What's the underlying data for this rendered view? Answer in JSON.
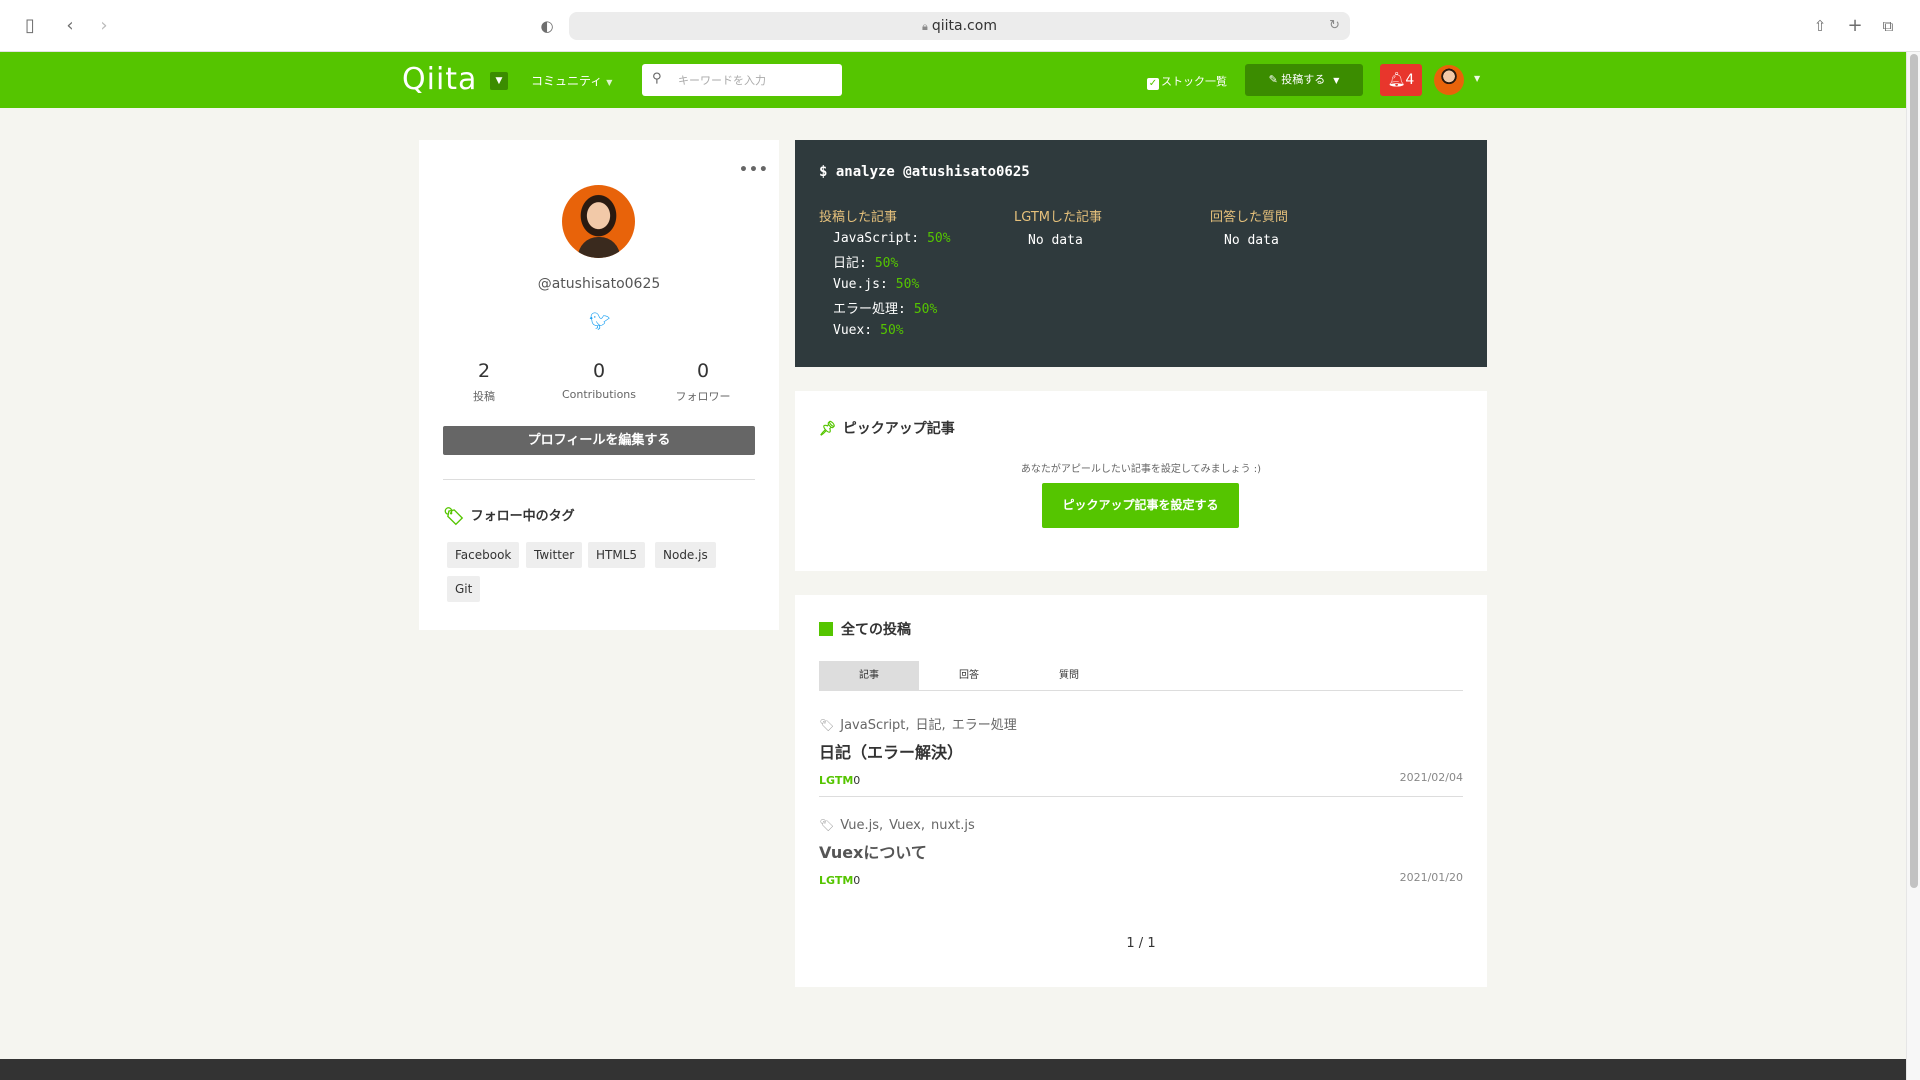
{
  "browser": {
    "url": "qiita.com"
  },
  "header": {
    "logo": "Qiita",
    "community_label": "コミュニティ",
    "search_placeholder": "キーワードを入力",
    "stock_label": "ストック一覧",
    "post_label": "投稿する",
    "notification_count": "4"
  },
  "profile": {
    "username": "@atushisato0625",
    "stats": [
      {
        "value": "2",
        "label": "投稿"
      },
      {
        "value": "0",
        "label": "Contributions"
      },
      {
        "value": "0",
        "label": "フォロワー"
      }
    ],
    "edit_button": "プロフィールを編集する",
    "following_tags_heading": "フォロー中のタグ",
    "tags": [
      "Facebook",
      "Twitter",
      "HTML5",
      "Node.js",
      "Git"
    ]
  },
  "analyze": {
    "command": "$ analyze @atushisato0625",
    "columns": [
      {
        "heading": "投稿した記事",
        "rows": [
          {
            "name": "JavaScript:",
            "pct": "50%"
          },
          {
            "name": "日記:",
            "pct": "50%"
          },
          {
            "name": "Vue.js:",
            "pct": "50%"
          },
          {
            "name": "エラー処理:",
            "pct": "50%"
          },
          {
            "name": "Vuex:",
            "pct": "50%"
          }
        ]
      },
      {
        "heading": "LGTMした記事",
        "nodata": "No data"
      },
      {
        "heading": "回答した質問",
        "nodata": "No data"
      }
    ]
  },
  "pickup": {
    "heading": "ピックアップ記事",
    "description": "あなたがアピールしたい記事を設定してみましょう :)",
    "button": "ピックアップ記事を設定する"
  },
  "posts": {
    "heading": "全ての投稿",
    "tabs": [
      "記事",
      "回答",
      "質問"
    ],
    "items": [
      {
        "tags": [
          "JavaScript,",
          "日記,",
          "エラー処理"
        ],
        "title": "日記（エラー解決）",
        "lgtm_label": "LGTM",
        "lgtm_count": "0",
        "date": "2021/02/04"
      },
      {
        "tags": [
          "Vue.js,",
          "Vuex,",
          "nuxt.js"
        ],
        "title": "Vuexについて",
        "lgtm_label": "LGTM",
        "lgtm_count": "0",
        "date": "2021/01/20"
      }
    ],
    "pagination": "1 / 1"
  },
  "colors": {
    "brand": "#55c500",
    "brand_dark": "#3b8c00",
    "notification": "#e8362c",
    "terminal_bg": "#2f3a3d",
    "terminal_heading": "#e5c07b"
  },
  "icons": {
    "sidebar_toggle": "sidebar-icon",
    "back": "chevron-left-icon",
    "forward": "chevron-right-icon",
    "shield": "shield-icon",
    "share": "share-icon",
    "new_tab": "plus-icon",
    "tabs": "tabs-icon",
    "search": "search-icon",
    "bell": "bell-icon",
    "twitter": "twitter-icon",
    "tag": "tag-icon",
    "pin": "pin-icon"
  }
}
